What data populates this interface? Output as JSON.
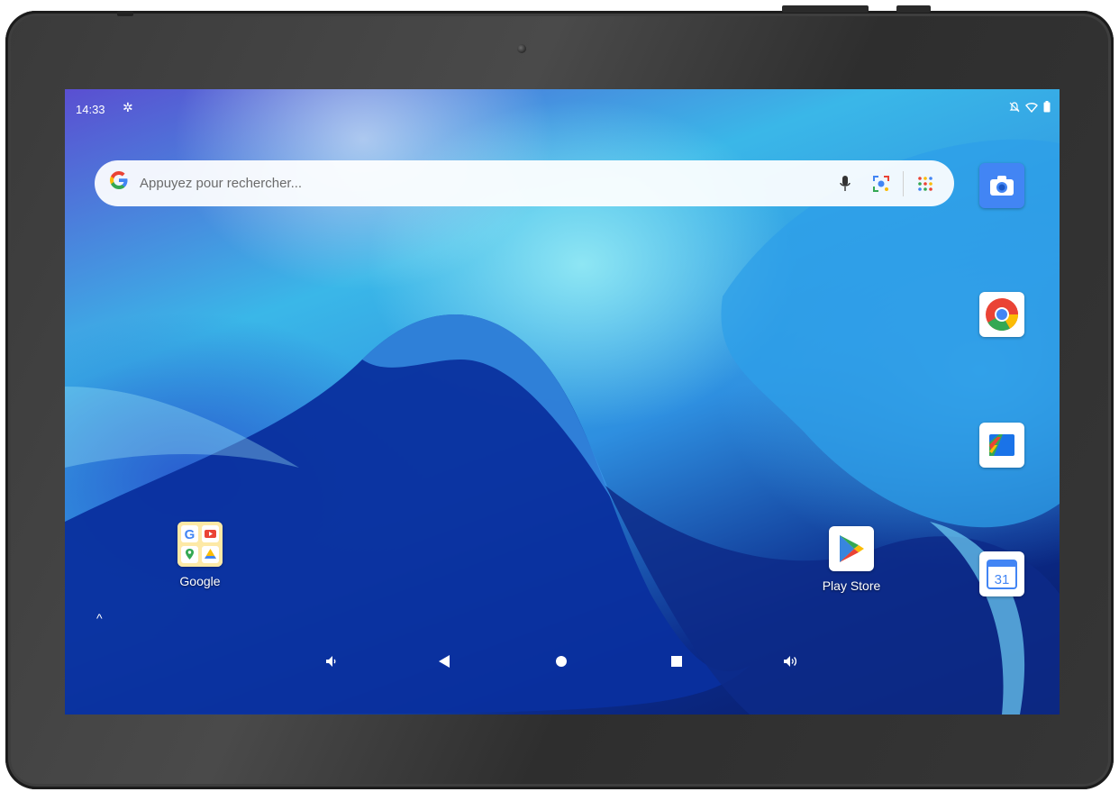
{
  "status_bar": {
    "time": "14:33",
    "settings_icon": "gear-icon",
    "right_icons": [
      "notifications-off-icon",
      "wifi-icon",
      "battery-icon"
    ]
  },
  "search": {
    "logo": "G",
    "placeholder": "Appuyez pour rechercher...",
    "icons": [
      "mic-icon",
      "lens-icon",
      "apps-grid-icon"
    ]
  },
  "apps": {
    "google_folder": {
      "label": "Google",
      "icon": "google-folder-icon"
    },
    "play_store": {
      "label": "Play Store",
      "icon": "play-store-icon"
    }
  },
  "dock": {
    "items": [
      {
        "name": "camera",
        "icon": "camera-icon"
      },
      {
        "name": "chrome",
        "icon": "chrome-icon"
      },
      {
        "name": "photos",
        "icon": "photos-icon"
      },
      {
        "name": "calendar",
        "icon": "calendar-icon",
        "text": "31"
      }
    ]
  },
  "drawer_arrow": "^",
  "nav": [
    "volume-down-icon",
    "back-icon",
    "home-icon",
    "recents-icon",
    "volume-up-icon"
  ],
  "colors": {
    "google_blue": "#4285f4",
    "google_red": "#ea4335",
    "google_yellow": "#fbbc05",
    "google_green": "#34a853",
    "bezel": "#3a3a3a"
  }
}
